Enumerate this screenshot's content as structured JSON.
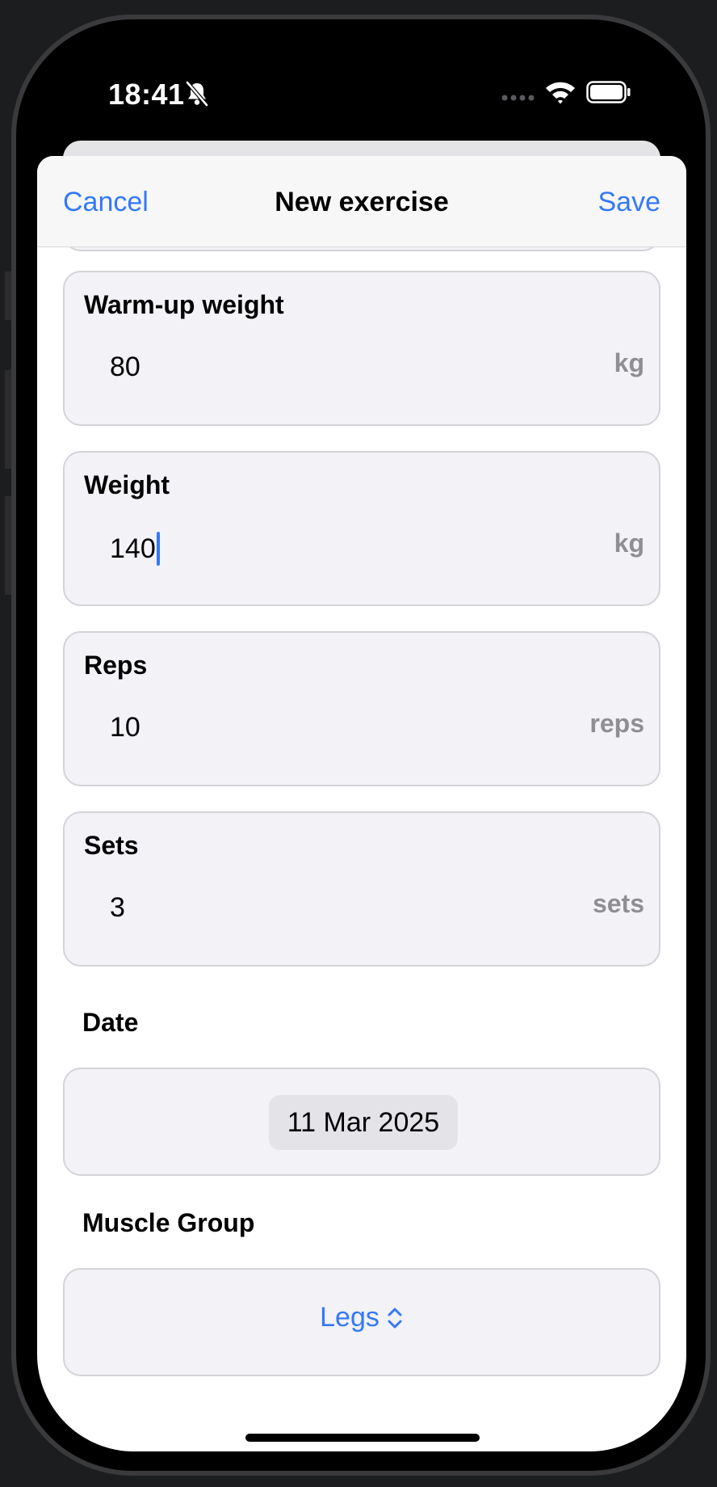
{
  "status_bar": {
    "time": "18:41"
  },
  "nav": {
    "cancel_label": "Cancel",
    "title": "New exercise",
    "save_label": "Save"
  },
  "fields": [
    {
      "label": "Warm-up weight",
      "value": "80",
      "unit": "kg"
    },
    {
      "label": "Weight",
      "value": "140",
      "unit": "kg"
    },
    {
      "label": "Reps",
      "value": "10",
      "unit": "reps"
    },
    {
      "label": "Sets",
      "value": "3",
      "unit": "sets"
    }
  ],
  "date_section": {
    "label": "Date",
    "value": "11 Mar 2025"
  },
  "muscle_group_section": {
    "label": "Muscle Group",
    "value": "Legs"
  },
  "colors": {
    "accent": "#3478f6",
    "card_background": "#f2f2f7",
    "unit_text": "#8e8e93"
  }
}
